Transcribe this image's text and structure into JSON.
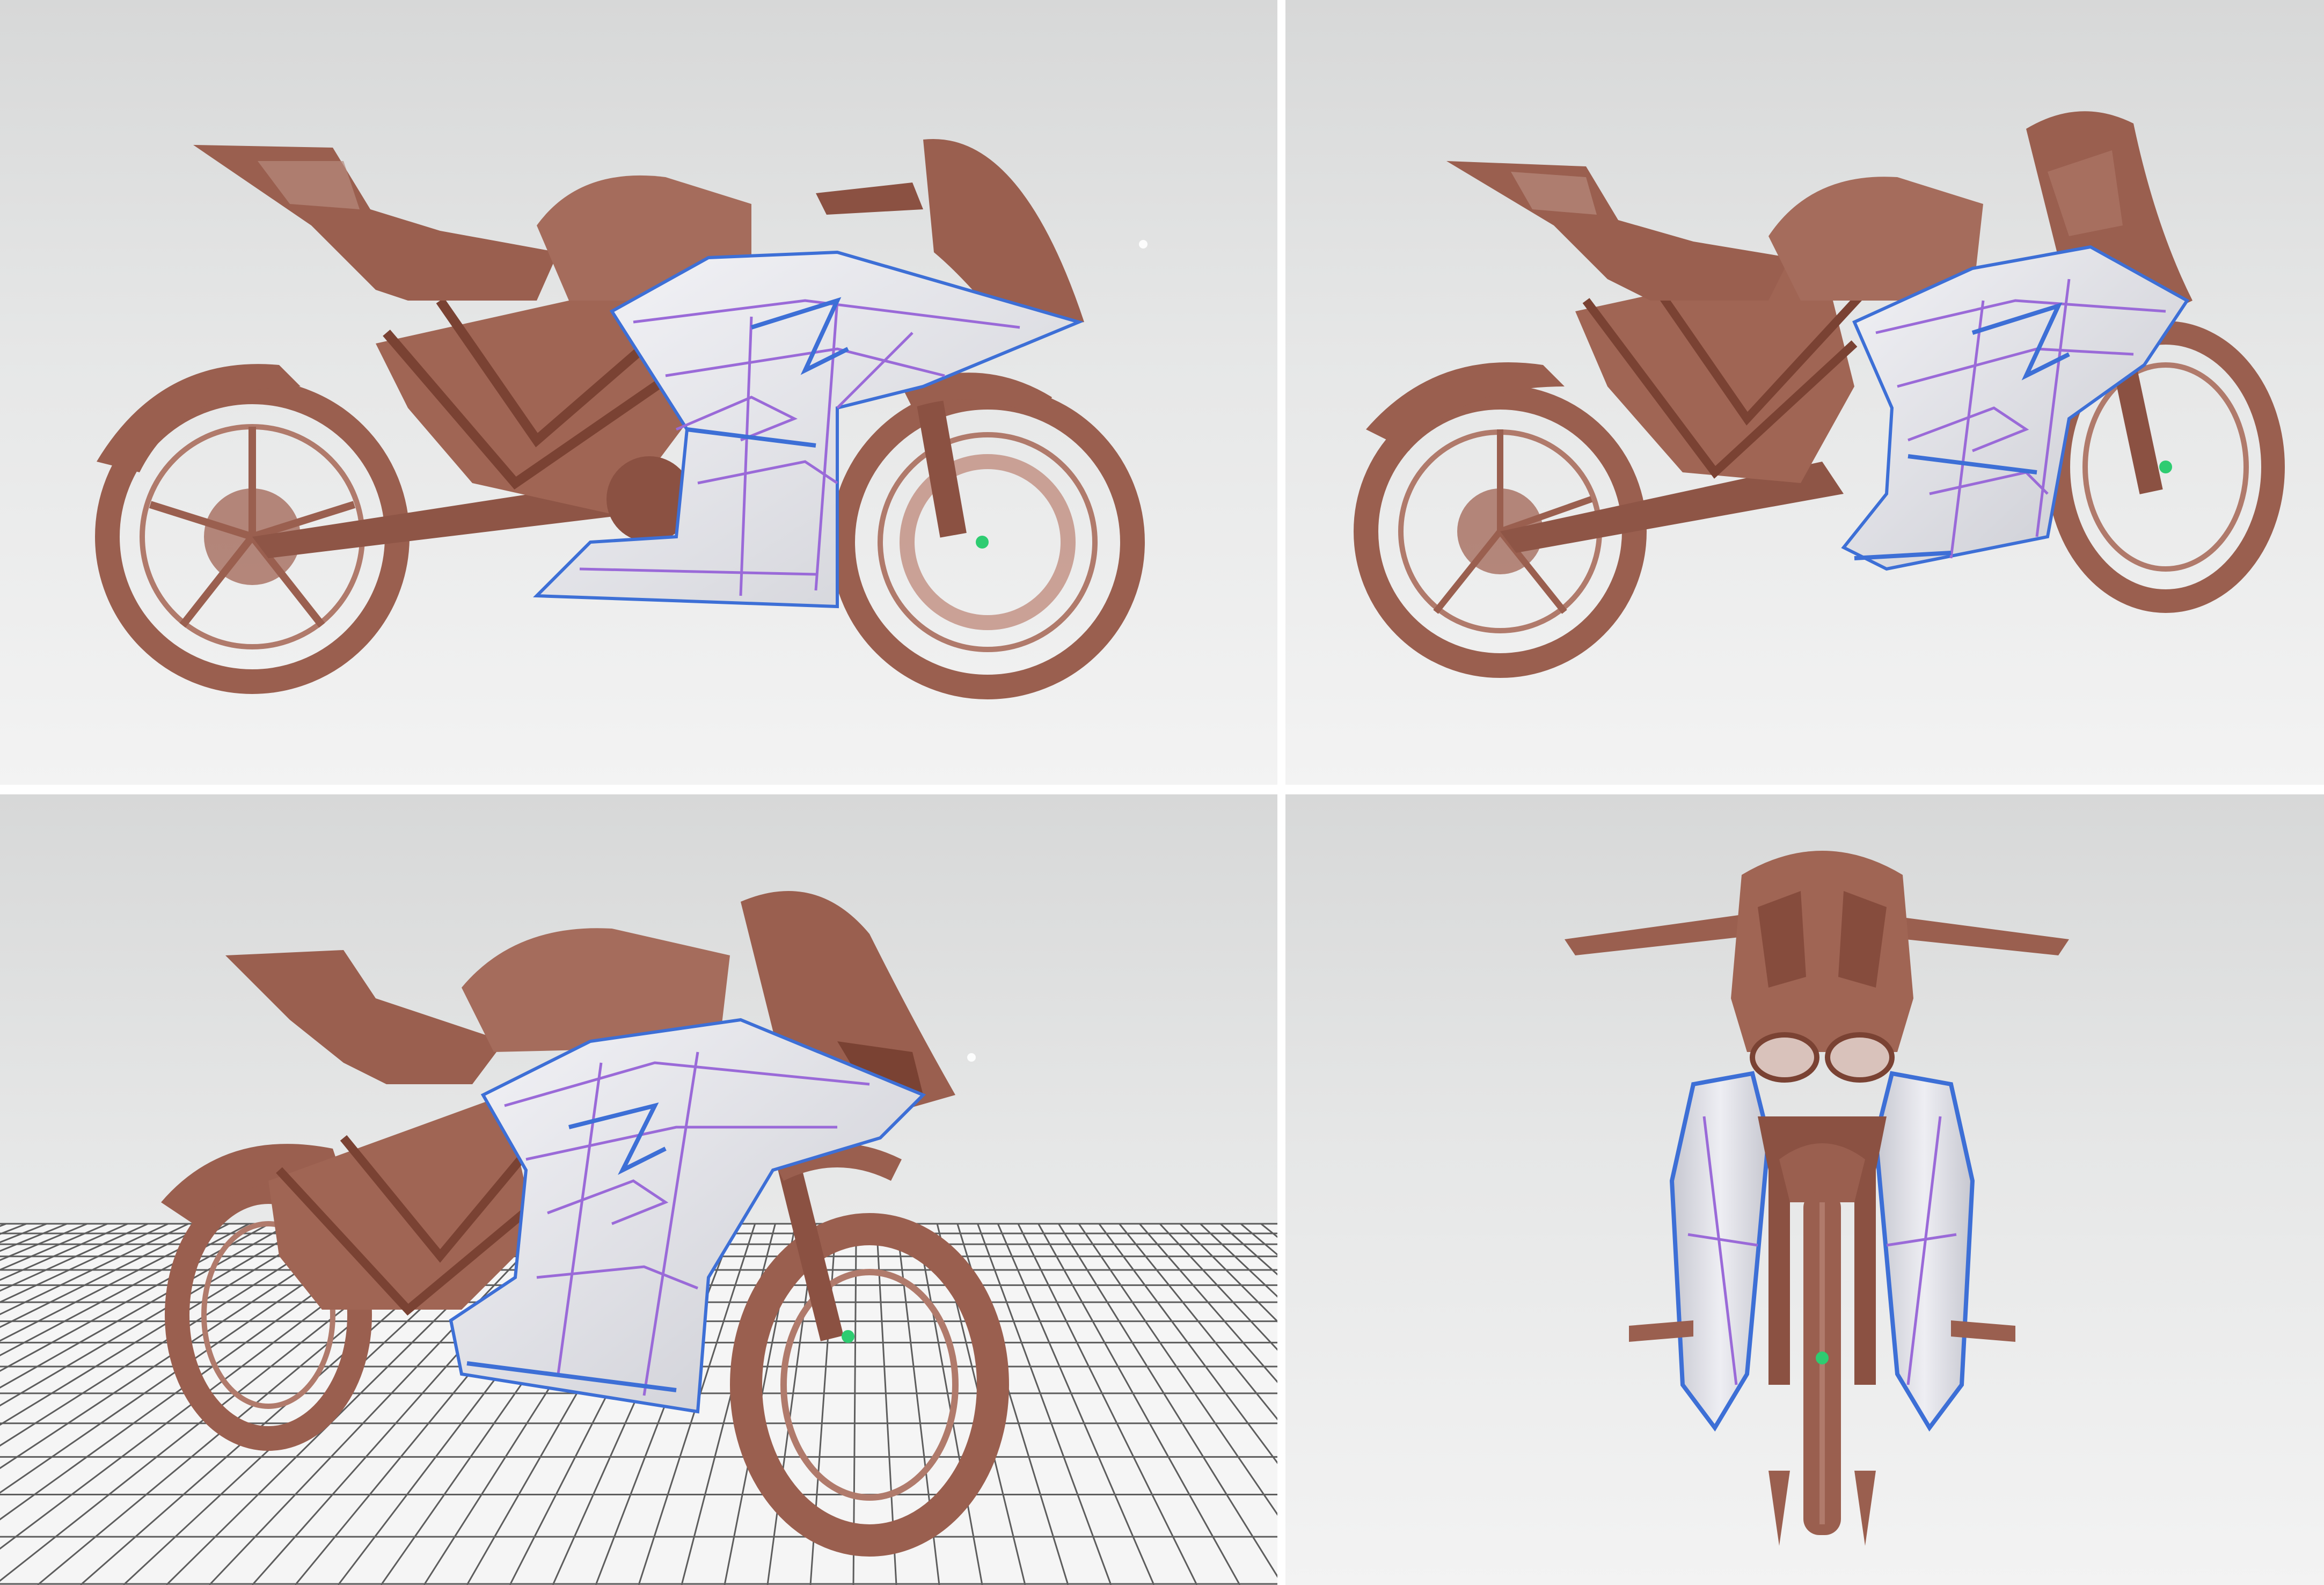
{
  "app": {
    "layout": "quad-viewport"
  },
  "colors": {
    "background_top": "#d7d8d8",
    "background_bottom": "#f3f3f3",
    "scan_points": "#9a5f4f",
    "scan_dark": "#7a4233",
    "surface_fill": "#e9e9ee",
    "surface_edge_blue": "#3d6fd6",
    "surface_edge_purple": "#9a6ad8",
    "pivot_green": "#2ecc71",
    "ground_grid": "#2b2b2b"
  },
  "viewports": [
    {
      "name": "perspective-side",
      "icon": "motorcycle-scan-side"
    },
    {
      "name": "perspective-three-quarter",
      "icon": "motorcycle-scan-quarter"
    },
    {
      "name": "perspective-grid",
      "icon": "motorcycle-scan-grid",
      "ground_grid": true
    },
    {
      "name": "front",
      "icon": "motorcycle-scan-front"
    }
  ]
}
